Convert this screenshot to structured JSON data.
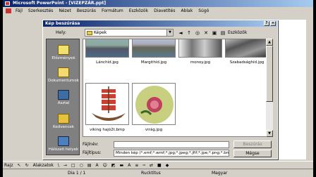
{
  "app": {
    "title": "Microsoft PowerPoint - [VIZEPZÁR.ppt]",
    "menu": [
      "Fájl",
      "Szerkesztés",
      "Nézet",
      "Beszúrás",
      "Formátum",
      "Eszközök",
      "Diavetítés",
      "Ablak",
      "Súgó"
    ]
  },
  "dialog": {
    "title": "Kép beszúrása",
    "look_in_label": "Hely:",
    "look_in_value": "Képek",
    "tools_label": "Eszközök",
    "places": [
      {
        "label": "Előzmények",
        "icon": "history-icon"
      },
      {
        "label": "Dokumentumok",
        "icon": "my-documents-icon"
      },
      {
        "label": "Asztal",
        "icon": "desktop-icon"
      },
      {
        "label": "Kedvencek",
        "icon": "favorites-icon"
      },
      {
        "label": "Hálózati helyek",
        "icon": "network-places-icon"
      }
    ],
    "files": [
      {
        "name": "Lánchíd.jpg"
      },
      {
        "name": "Margithíd.jpg"
      },
      {
        "name": "monoy.jpg"
      },
      {
        "name": "Szabadsághíd.jpg"
      },
      {
        "name": "viking hajó2t.bmp"
      },
      {
        "name": "virág.jpg"
      }
    ],
    "filename_label": "Fájlnév:",
    "filename_value": "",
    "filetype_label": "Fájltípus:",
    "filetype_value": "Minden kép (*.emf;*.wmf;*.jpg;*.jpeg;*.jfif;*.jpe;*.png;*.bmp;*.dib;*.rle;*.bmz;*.gif;*.gfa;*.emz;*.wmz;*.pcz;*.tif;*.tiff;*.cdr;*.cgm)",
    "insert_label": "Beszúrás",
    "cancel_label": "Mégse"
  },
  "drawbar": {
    "draw_label": "Rajz",
    "autoshapes_label": "Alakzatok"
  },
  "status": {
    "slide": "Dia 1 / 1",
    "design": "Rucktitus",
    "language": "Magyar"
  }
}
